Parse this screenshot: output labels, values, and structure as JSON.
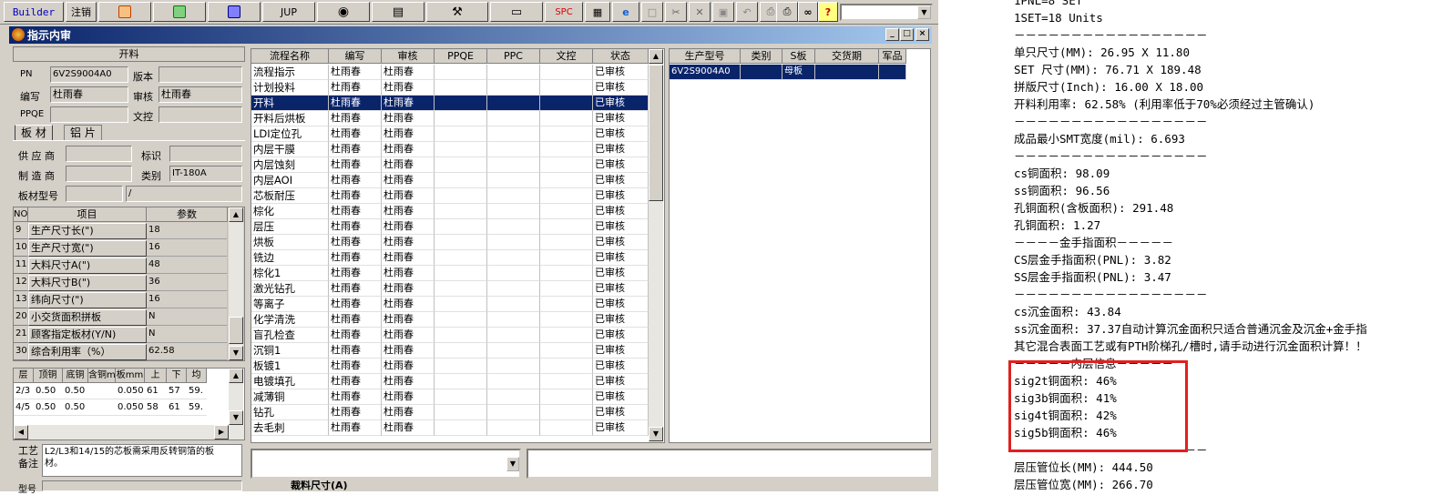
{
  "toolbar": {
    "builder": "Builder",
    "zhuxiao": "注销",
    "jup": "JUP",
    "spc": "SPC"
  },
  "window": {
    "title": "指示内审",
    "min": "_",
    "max": "□",
    "close": "×"
  },
  "kailiao": {
    "section": "开料",
    "pn_label": "PN",
    "pn_value": "6V2S9004A0",
    "banben_label": "版本",
    "banben_value": "",
    "bianxie_label": "编写",
    "bianxie_value": "杜雨春",
    "shenhe_label": "审核",
    "shenhe_value": "杜雨春",
    "ppqe_label": "PPQE",
    "ppqe_value": "",
    "wenkong_label": "文控",
    "wenkong_value": ""
  },
  "tabs": {
    "bancai": "板 材",
    "lupian": "铝 片"
  },
  "supplier": {
    "gys_label": "供 应 商",
    "gys_value": "",
    "biaoshi_label": "标识",
    "biaoshi_value": "",
    "zzs_label": "制 造 商",
    "zzs_value": "",
    "leibie_label": "类别",
    "leibie_value": "IT-180A",
    "bcxh_label": "板材型号",
    "bcxh_value": "",
    "bcxh_value2": "/"
  },
  "params": {
    "headers": [
      "NO",
      "项目",
      "参数"
    ],
    "rows": [
      {
        "no": "9",
        "item": "生产尺寸长(\")",
        "val": "18"
      },
      {
        "no": "10",
        "item": "生产尺寸宽(\")",
        "val": "16"
      },
      {
        "no": "11",
        "item": "大料尺寸A(\")",
        "val": "48"
      },
      {
        "no": "12",
        "item": "大料尺寸B(\")",
        "val": "36"
      },
      {
        "no": "13",
        "item": "纬向尺寸(\")",
        "val": "16"
      },
      {
        "no": "20",
        "item": "小交货面积拼板",
        "val": "N"
      },
      {
        "no": "21",
        "item": "顾客指定板材(Y/N)",
        "val": "N"
      },
      {
        "no": "30",
        "item": "综合利用率（%）",
        "val": "62.58"
      }
    ]
  },
  "layers": {
    "headers": [
      "层",
      "顶铜",
      "底铜",
      "含铜mm",
      "板mm",
      "上",
      "下",
      "均"
    ],
    "rows": [
      [
        "2/3",
        "0.50",
        "0.50",
        "",
        "0.050",
        "61",
        "57",
        "59."
      ],
      [
        "4/5",
        "0.50",
        "0.50",
        "",
        "0.050",
        "58",
        "61",
        "59."
      ]
    ]
  },
  "process": {
    "label1": "工艺",
    "label2": "备注",
    "text": "L2/L3和14/15的芯板需采用反转铜箔的板材。",
    "label3": "型号"
  },
  "flow": {
    "headers": [
      "流程名称",
      "编写",
      "审核",
      "PPQE",
      "PPC",
      "文控",
      "状态"
    ],
    "rows": [
      [
        "流程指示",
        "杜雨春",
        "杜雨春",
        "",
        "",
        "",
        "已审核"
      ],
      [
        "计划投料",
        "杜雨春",
        "杜雨春",
        "",
        "",
        "",
        "已审核"
      ],
      [
        "开料",
        "杜雨春",
        "杜雨春",
        "",
        "",
        "",
        "已审核"
      ],
      [
        "开料后烘板",
        "杜雨春",
        "杜雨春",
        "",
        "",
        "",
        "已审核"
      ],
      [
        "LDI定位孔",
        "杜雨春",
        "杜雨春",
        "",
        "",
        "",
        "已审核"
      ],
      [
        "内层干膜",
        "杜雨春",
        "杜雨春",
        "",
        "",
        "",
        "已审核"
      ],
      [
        "内层蚀刻",
        "杜雨春",
        "杜雨春",
        "",
        "",
        "",
        "已审核"
      ],
      [
        "内层AOI",
        "杜雨春",
        "杜雨春",
        "",
        "",
        "",
        "已审核"
      ],
      [
        "芯板耐压",
        "杜雨春",
        "杜雨春",
        "",
        "",
        "",
        "已审核"
      ],
      [
        "棕化",
        "杜雨春",
        "杜雨春",
        "",
        "",
        "",
        "已审核"
      ],
      [
        "层压",
        "杜雨春",
        "杜雨春",
        "",
        "",
        "",
        "已审核"
      ],
      [
        "烘板",
        "杜雨春",
        "杜雨春",
        "",
        "",
        "",
        "已审核"
      ],
      [
        "铣边",
        "杜雨春",
        "杜雨春",
        "",
        "",
        "",
        "已审核"
      ],
      [
        "棕化1",
        "杜雨春",
        "杜雨春",
        "",
        "",
        "",
        "已审核"
      ],
      [
        "激光钻孔",
        "杜雨春",
        "杜雨春",
        "",
        "",
        "",
        "已审核"
      ],
      [
        "等离子",
        "杜雨春",
        "杜雨春",
        "",
        "",
        "",
        "已审核"
      ],
      [
        "化学清洗",
        "杜雨春",
        "杜雨春",
        "",
        "",
        "",
        "已审核"
      ],
      [
        "盲孔检查",
        "杜雨春",
        "杜雨春",
        "",
        "",
        "",
        "已审核"
      ],
      [
        "沉铜1",
        "杜雨春",
        "杜雨春",
        "",
        "",
        "",
        "已审核"
      ],
      [
        "板镀1",
        "杜雨春",
        "杜雨春",
        "",
        "",
        "",
        "已审核"
      ],
      [
        "电镀填孔",
        "杜雨春",
        "杜雨春",
        "",
        "",
        "",
        "已审核"
      ],
      [
        "减薄铜",
        "杜雨春",
        "杜雨春",
        "",
        "",
        "",
        "已审核"
      ],
      [
        "钻孔",
        "杜雨春",
        "杜雨春",
        "",
        "",
        "",
        "已审核"
      ],
      [
        "去毛刺",
        "杜雨春",
        "杜雨春",
        "",
        "",
        "",
        "已审核"
      ]
    ],
    "selected": 2
  },
  "product": {
    "headers": [
      "生产型号",
      "类别",
      "S板",
      "交货期",
      "军品"
    ],
    "rows": [
      [
        "6V2S9004A0",
        "",
        "母板",
        "",
        ""
      ]
    ]
  },
  "bottom": {
    "tab_label": "裁料尺寸(A)"
  },
  "report": {
    "lines": [
      "1PNL=8 SET",
      "1SET=18 Units",
      "－－－－－－－－－－－－－－－－－",
      "单只尺寸(MM): 26.95 X 11.80",
      "SET 尺寸(MM): 76.71 X 189.48",
      "拼版尺寸(Inch): 16.00 X 18.00",
      "开料利用率: 62.58% (利用率低于70%必须经过主管确认)",
      "－－－－－－－－－－－－－－－－－",
      "成品最小SMT宽度(mil): 6.693",
      "－－－－－－－－－－－－－－－－－",
      "cs铜面积: 98.09",
      "ss铜面积: 96.56",
      "孔铜面积(含板面积): 291.48",
      "孔铜面积: 1.27",
      "－－－－金手指面积－－－－－",
      "CS层金手指面积(PNL): 3.82",
      "SS层金手指面积(PNL): 3.47",
      "－－－－－－－－－－－－－－－－－",
      "cs沉金面积: 43.84",
      "ss沉金面积: 37.37自动计算沉金面积只适合普通沉金及沉金+金手指",
      "其它混合表面工艺或有PTH阶梯孔/槽时,请手动进行沉金面积计算！！",
      "－－－－－内层信息－－－－－",
      "sig2t铜面积: 46%",
      "sig3b铜面积: 41%",
      "sig4t铜面积: 42%",
      "sig5b铜面积: 46%",
      "－－－－－－－－－－－－－－－－－",
      "层压管位长(MM): 444.50",
      "层压管位宽(MM): 266.70"
    ]
  }
}
